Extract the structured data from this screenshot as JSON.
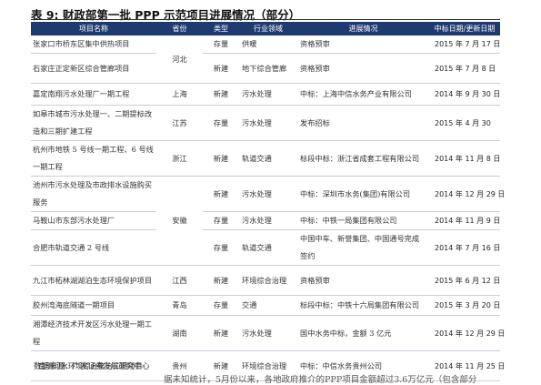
{
  "title": "表 9: 财政部第一批 PPP 示范项目进展情况（部分）",
  "headers": [
    "项目名称",
    "省份",
    "类型",
    "行业领域",
    "进展情况",
    "中标日期/更新日期"
  ],
  "rows": [
    [
      "张家口市桥东区集中供热项目",
      "河北",
      "存量",
      "供暖",
      "资格预审",
      "2015 年 7 月 17 日"
    ],
    [
      "石家庄正定新区综合管廊项目",
      "",
      "新建",
      "地下综合管廊",
      "资格预审",
      "2015 年 7 月 8 日"
    ],
    [
      "嘉定南翔污水处理厂一期工程",
      "上海",
      "新建",
      "污水处理",
      "中标：上海中信水务产业有限公司",
      "2014 年 9 月 30 日"
    ],
    [
      "如皋市城市污水处理一、二期提标改造和三期扩建工程",
      "江苏",
      "存量",
      "污水处理",
      "发布招标",
      "2015 年 4 月 30"
    ],
    [
      "杭州市地铁 5 号线一期工程、6 号线一期工程",
      "浙江",
      "新建",
      "轨道交通",
      "标段中标：浙江省成套工程有限公司",
      "2014 年 11 月 8 日"
    ],
    [
      "池州市污水处理及市政排水设施购买服务",
      "安徽",
      "新建",
      "污水处理",
      "中标：深圳市水务(集团)有限公司",
      "2014 年 12 月 29 日"
    ],
    [
      "马鞍山市东部污水处理厂",
      "",
      "存量",
      "污水处理",
      "中标：中铁一局集团有限公司",
      "2014 年 11 月 9 日"
    ],
    [
      "合肥市轨道交通 2 号线",
      "",
      "存量",
      "轨道交通",
      "中国中车、新誉集团、中国通号完成签约",
      "2014 年 7 月 16 日"
    ],
    [
      "九江市柘林湖湖泊生态环境保护项目",
      "江西",
      "新建",
      "环境综合治理",
      "资格预审",
      "2015 年 6 月 12 日"
    ],
    [
      "胶州湾海底隧道一期项目",
      "青岛",
      "存量",
      "交通",
      "标段中标：中铁十六局集团有限公司",
      "2015 年 3 月 20 日"
    ],
    [
      "湘潭经济技术开发区污水处理一期工程",
      "湖南",
      "新建",
      "污水处理",
      "国中水务中标，金额 3 亿元",
      "2014 年 12 月 29 日"
    ],
    [
      "南明河水环境综合整治二期项目",
      "贵州",
      "新建",
      "环境综合治理",
      "中标：中信水务贵州公司",
      "2014 年 11 月 25 日"
    ]
  ],
  "source": "数据来源：广发证券发展研究中心",
  "cutoff_line": "据未知统计，5月份以来，各地政府推介的PPP项目金额超过3.6万亿元（包含部分"
}
